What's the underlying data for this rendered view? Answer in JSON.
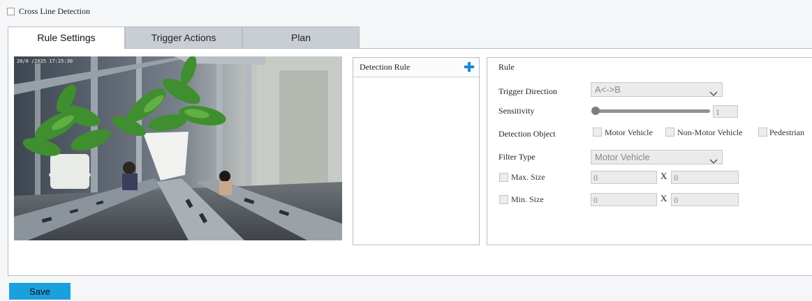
{
  "header": {
    "enable_checkbox_label": "Cross Line Detection"
  },
  "tabs": [
    {
      "label": "Rule Settings",
      "active": true
    },
    {
      "label": "Trigger Actions",
      "active": false
    },
    {
      "label": "Plan",
      "active": false
    }
  ],
  "video": {
    "osd_timestamp": "20/0 /2025 17:25:30"
  },
  "rule_list": {
    "header_label": "Detection Rule",
    "add_icon": "plus-icon",
    "items": []
  },
  "rule_panel": {
    "title": "Rule",
    "trigger_direction": {
      "label": "Trigger Direction",
      "value": "A<->B"
    },
    "sensitivity": {
      "label": "Sensitivity",
      "value": "1"
    },
    "detection_object": {
      "label": "Detection Object",
      "options": [
        "Motor Vehicle",
        "Non-Motor Vehicle",
        "Pedestrian"
      ]
    },
    "filter_type": {
      "label": "Filter Type",
      "value": "Motor Vehicle"
    },
    "max_size": {
      "label": "Max. Size",
      "width": "0",
      "separator": "X",
      "height": "0"
    },
    "min_size": {
      "label": "Min. Size",
      "width": "0",
      "separator": "X",
      "height": "0"
    }
  },
  "footer": {
    "save_label": "Save"
  },
  "colors": {
    "accent": "#1aa0dc",
    "plus_icon": "#1a8bd0",
    "tab_inactive": "#c9ced5"
  }
}
